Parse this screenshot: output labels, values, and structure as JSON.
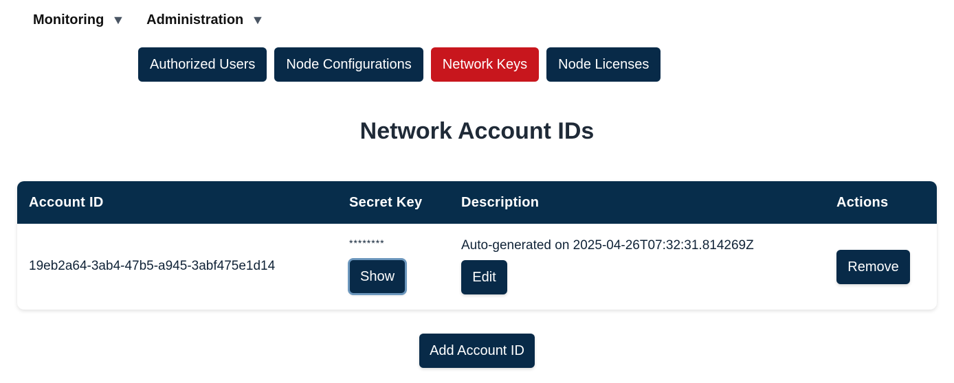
{
  "topnav": {
    "items": [
      {
        "label": "Monitoring",
        "caret": "▼"
      },
      {
        "label": "Administration",
        "caret": "▼"
      }
    ]
  },
  "tabs": [
    {
      "label": "Authorized Users",
      "active": false
    },
    {
      "label": "Node Configurations",
      "active": false
    },
    {
      "label": "Network Keys",
      "active": true
    },
    {
      "label": "Node Licenses",
      "active": false
    }
  ],
  "page": {
    "title": "Network Account IDs"
  },
  "table": {
    "headers": {
      "account_id": "Account ID",
      "secret_key": "Secret Key",
      "description": "Description",
      "actions": "Actions"
    },
    "rows": [
      {
        "account_id": "19eb2a64-3ab4-47b5-a945-3abf475e1d14",
        "secret_key": "********",
        "show_label": "Show",
        "description": "Auto-generated on 2025-04-26T07:32:31.814269Z",
        "edit_label": "Edit",
        "remove_label": "Remove"
      }
    ]
  },
  "add_button_label": "Add Account ID",
  "colors": {
    "primary": "#082a48",
    "active_tab": "#c8161d",
    "header_bg": "#072d4b"
  }
}
